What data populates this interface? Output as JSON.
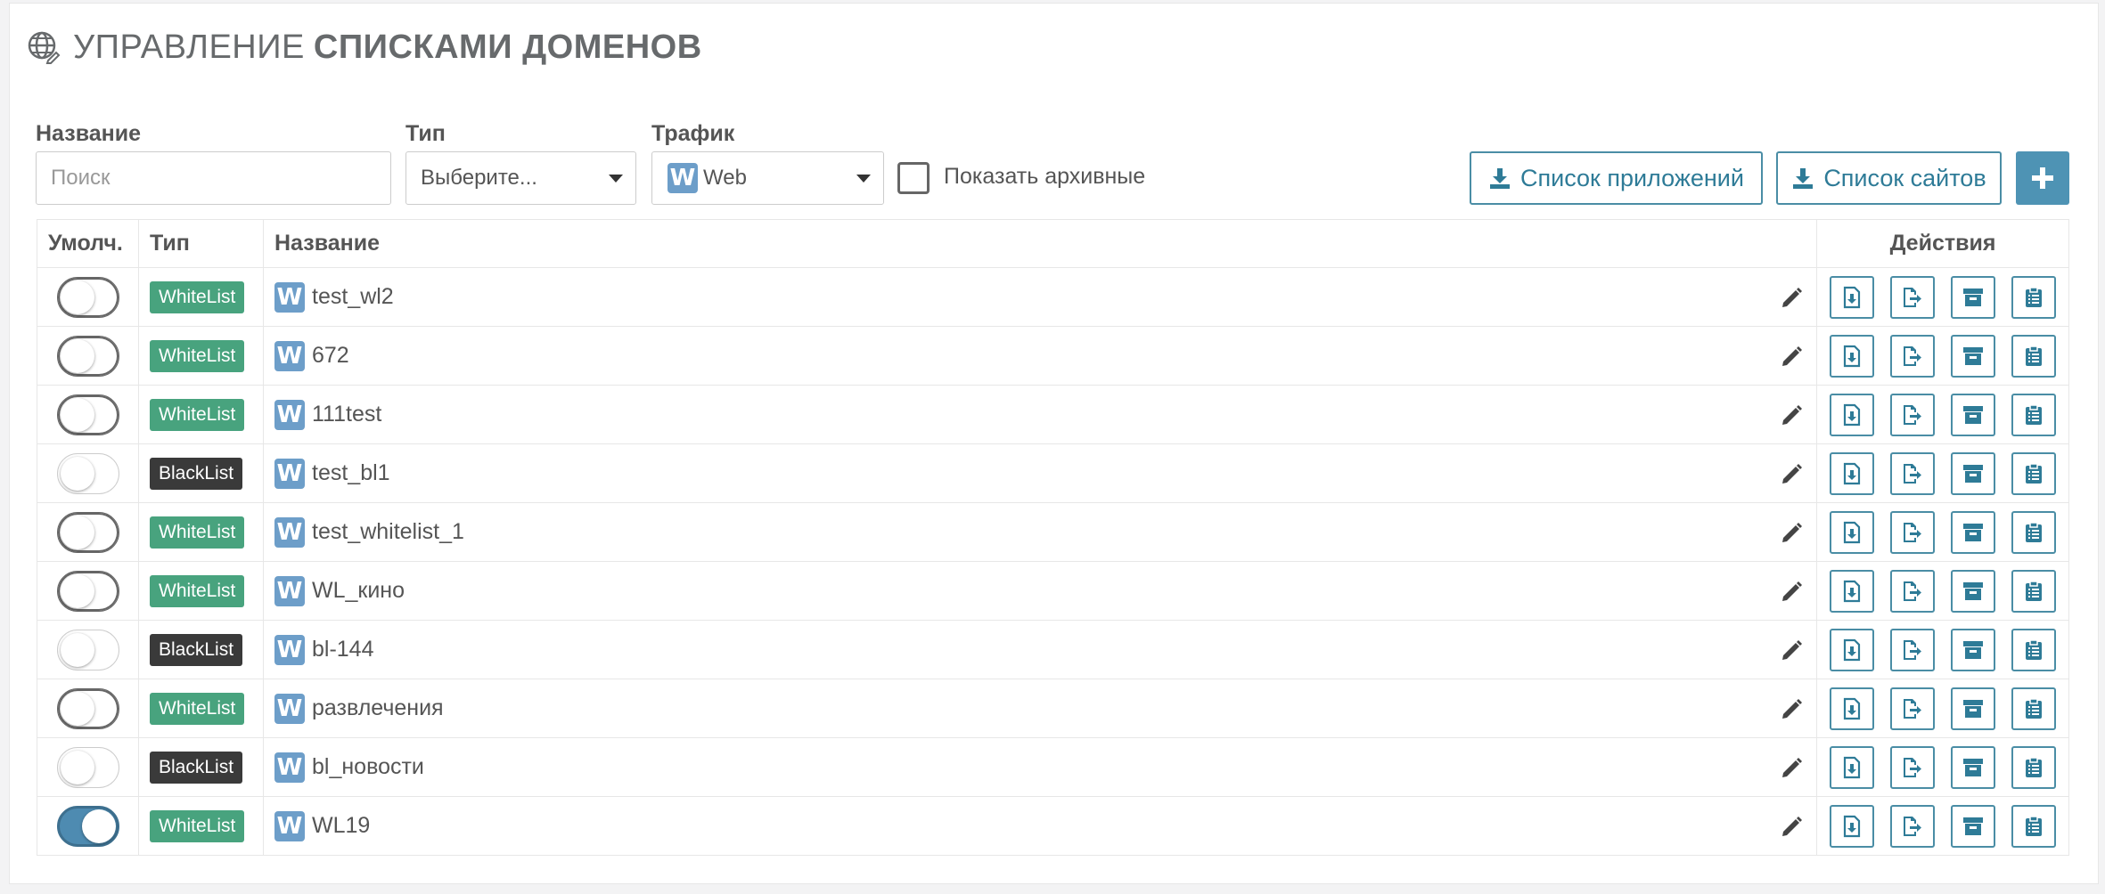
{
  "header": {
    "title_light": "УПРАВЛЕНИЕ",
    "title_bold": "СПИСКАМИ ДОМЕНОВ",
    "icon": "globe-icon"
  },
  "filters": {
    "name_label": "Название",
    "name_placeholder": "Поиск",
    "type_label": "Тип",
    "type_value": "Выберите...",
    "traffic_label": "Трафик",
    "traffic_badge": "W",
    "traffic_value": "Web",
    "archived_label": "Показать архивные"
  },
  "buttons": {
    "apps_list": "Список приложений",
    "sites_list": "Список сайтов",
    "add": "+"
  },
  "table": {
    "headers": {
      "default": "Умолч.",
      "type": "Тип",
      "name": "Название",
      "actions": "Действия"
    },
    "rows": [
      {
        "default": false,
        "type": "WhiteList",
        "name": "test_wl2"
      },
      {
        "default": false,
        "type": "WhiteList",
        "name": "672"
      },
      {
        "default": false,
        "type": "WhiteList",
        "name": "111test"
      },
      {
        "default": false,
        "type": "BlackList",
        "name": "test_bl1"
      },
      {
        "default": false,
        "type": "WhiteList",
        "name": "test_whitelist_1"
      },
      {
        "default": false,
        "type": "WhiteList",
        "name": "WL_кино"
      },
      {
        "default": false,
        "type": "BlackList",
        "name": "bl-144"
      },
      {
        "default": false,
        "type": "WhiteList",
        "name": "развлечения"
      },
      {
        "default": false,
        "type": "BlackList",
        "name": "bl_новости"
      },
      {
        "default": true,
        "type": "WhiteList",
        "name": "WL19"
      }
    ]
  },
  "colors": {
    "accent": "#4a8da5",
    "whitelist": "#48a37e",
    "blacklist": "#3a3a3a",
    "web_badge": "#6d9ec9"
  }
}
